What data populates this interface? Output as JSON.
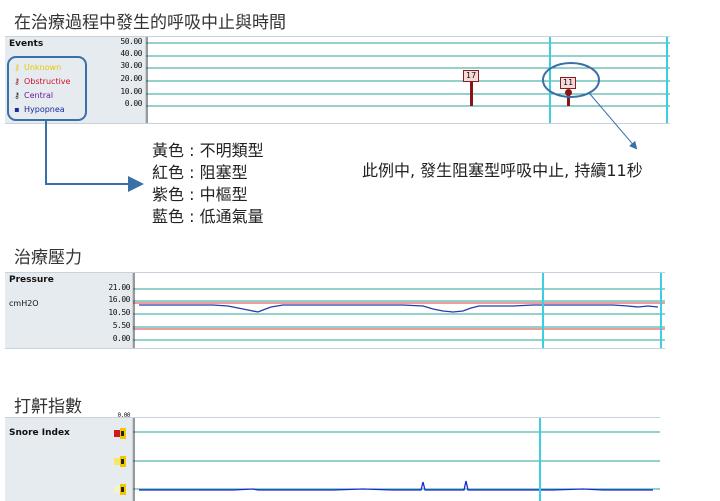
{
  "headings": {
    "events_title": "在治療過程中發生的呼吸中止與時間",
    "pressure_title": "治療壓力",
    "snore_title": "打鼾指數"
  },
  "events_panel": {
    "title": "Events",
    "y_ticks": [
      "50.00",
      "40.00",
      "30.00",
      "20.00",
      "10.00",
      "0.00"
    ],
    "legend": [
      {
        "label": "Unknown",
        "color": "#e8c800",
        "icon": "key-icon"
      },
      {
        "label": "Obstructive",
        "color": "#d0102a",
        "icon": "key-icon"
      },
      {
        "label": "Central",
        "color": "#6a1aa0",
        "icon": "key-icon"
      },
      {
        "label": "Hypopnea",
        "color": "#1a2a9a",
        "icon": "square-icon"
      }
    ],
    "events": [
      {
        "label": "17",
        "value": 17
      },
      {
        "label": "11",
        "value": 11
      }
    ]
  },
  "annotations": {
    "color_legend": [
      "黃色 : 不明類型",
      "紅色 : 阻塞型",
      "紫色 : 中樞型",
      "藍色 : 低通氣量"
    ],
    "example_note": "此例中, 發生阻塞型呼吸中止, 持續11秒"
  },
  "pressure_panel": {
    "title": "Pressure",
    "unit": "cmH2O",
    "y_ticks": [
      "21.00",
      "16.00",
      "10.50",
      "5.50",
      "0.00"
    ],
    "limit_lines": [
      16,
      3
    ]
  },
  "snore_panel": {
    "title": "Snore Index",
    "top_tick": "0.00"
  },
  "colors": {
    "grid": "#2aa39a",
    "marker": "#3ccfe0",
    "callout": "#3a6fa8",
    "pressure_line": "#2a3aa8",
    "limit_line": "#e03a3a",
    "snore_line": "#1a2ad0"
  }
}
